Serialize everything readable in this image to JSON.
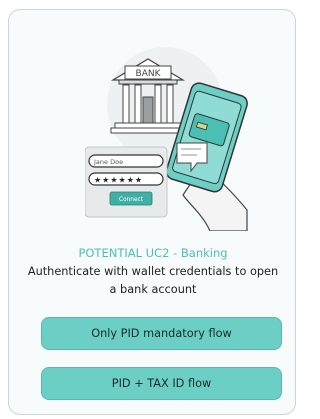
{
  "card": {
    "title": "POTENTIAL UC2 - Banking",
    "description": "Authenticate with wallet credentials to open a bank account",
    "illustration": {
      "bank_sign": "BANK",
      "username_value": "Jane Doe",
      "password_mask": "★★★★★★",
      "connect_label": "Connect"
    },
    "buttons": [
      {
        "label": "Only PID mandatory flow"
      },
      {
        "label": "PID + TAX ID flow"
      }
    ]
  },
  "colors": {
    "accent": "#4bbfb4",
    "button_bg": "#6ccfc6",
    "card_bg": "#f7fbfb"
  }
}
